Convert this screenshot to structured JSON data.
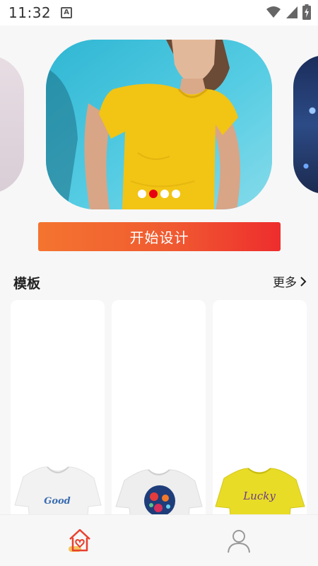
{
  "status_bar": {
    "time": "11:32",
    "notification_icon": "a-icon",
    "wifi_icon": "wifi-icon",
    "signal_icon": "signal-icon",
    "battery_icon": "battery-charging-icon"
  },
  "carousel": {
    "slide_count": 4,
    "active_index": 1
  },
  "start_button": {
    "label": "开始设计"
  },
  "templates_section": {
    "title": "模板",
    "more_label": "更多",
    "cards": [
      {
        "print_text": "Good",
        "shirt_color": "#f2f2f2"
      },
      {
        "print_text": "",
        "shirt_color": "#eeeeee"
      },
      {
        "print_text": "Lucky",
        "shirt_color": "#e8dc27"
      }
    ]
  },
  "bottom_nav": {
    "items": [
      {
        "icon": "home-heart-icon",
        "active": true
      },
      {
        "icon": "user-icon",
        "active": false
      }
    ]
  },
  "colors": {
    "accent_red": "#e60012",
    "button_gradient_start": "#f4742f",
    "button_gradient_end": "#ee2d2d"
  }
}
